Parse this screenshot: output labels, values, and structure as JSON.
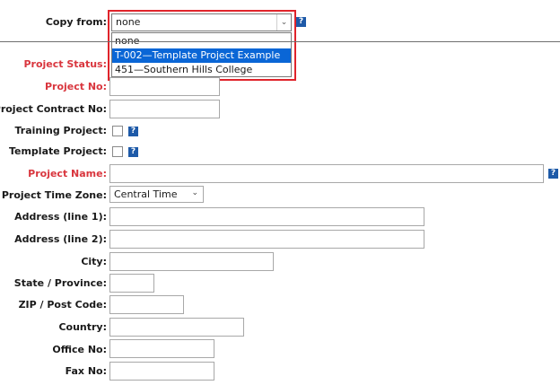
{
  "copy_from": {
    "label": "Copy from:",
    "selected": "none",
    "options": [
      "none",
      "T-002—Template Project Example",
      "451—Southern Hills College"
    ],
    "highlighted_index": 1
  },
  "fields": {
    "project_status": "Project Status:",
    "project_no": "Project No:",
    "project_contract_no": "Project Contract No:",
    "training_project": "Training Project:",
    "template_project": "Template Project:",
    "project_name": "Project Name:",
    "project_time_zone": "Project Time Zone:",
    "address1": "Address (line 1):",
    "address2": "Address (line 2):",
    "city": "City:",
    "state": "State / Province:",
    "zip": "ZIP / Post Code:",
    "country": "Country:",
    "office_no": "Office No:",
    "fax_no": "Fax No:"
  },
  "time_zone_value": "Central Time",
  "help_glyph": "?",
  "icons": {
    "help": "help-icon",
    "dropdown": "chevron-down-icon"
  },
  "colors": {
    "required_label": "#d9363e",
    "highlight": "#0a66d6",
    "help_bg": "#1e5aa8",
    "callout_border": "#e0242b"
  }
}
